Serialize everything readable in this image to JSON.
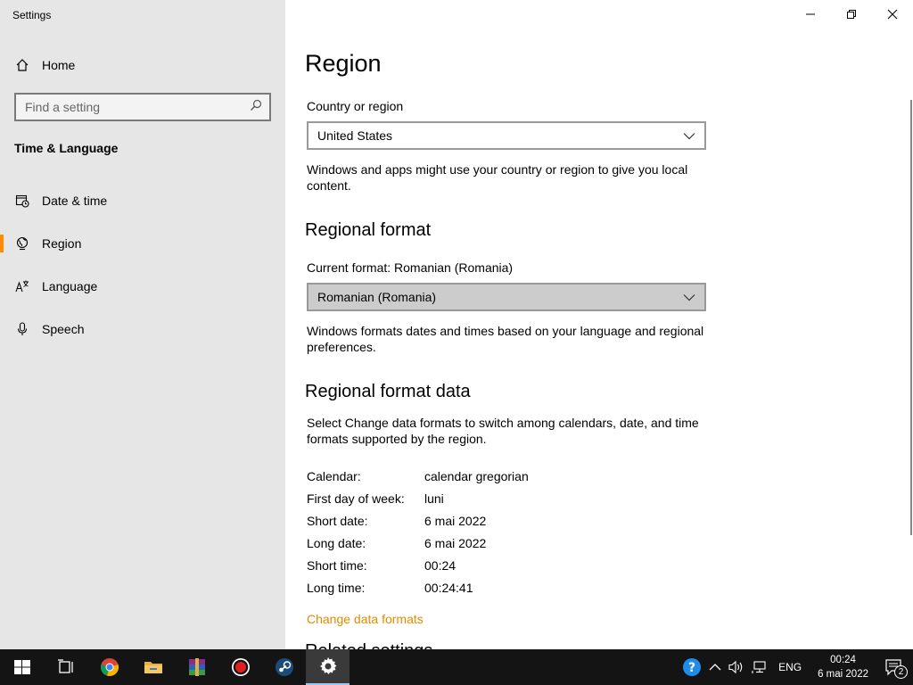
{
  "window": {
    "title": "Settings"
  },
  "sidebar": {
    "home_label": "Home",
    "search_placeholder": "Find a setting",
    "section_title": "Time & Language",
    "items": [
      {
        "label": "Date & time",
        "icon": "calendar-clock-icon"
      },
      {
        "label": "Region",
        "icon": "globe-icon",
        "active": true
      },
      {
        "label": "Language",
        "icon": "language-icon"
      },
      {
        "label": "Speech",
        "icon": "microphone-icon"
      }
    ],
    "accent": "#ff8c00"
  },
  "main": {
    "title": "Region",
    "country": {
      "label": "Country or region",
      "value": "United States",
      "desc": "Windows and apps might use your country or region to give you local content."
    },
    "regional_format": {
      "title": "Regional format",
      "current_label": "Current format: Romanian (Romania)",
      "value": "Romanian (Romania)",
      "desc": "Windows formats dates and times based on your language and regional preferences."
    },
    "format_data": {
      "title": "Regional format data",
      "desc": "Select Change data formats to switch among calendars, date, and time formats supported by the region.",
      "rows": [
        {
          "k": "Calendar:",
          "v": "calendar gregorian"
        },
        {
          "k": "First day of week:",
          "v": "luni"
        },
        {
          "k": "Short date:",
          "v": "6 mai 2022"
        },
        {
          "k": "Long date:",
          "v": "6 mai 2022"
        },
        {
          "k": "Short time:",
          "v": "00:24"
        },
        {
          "k": "Long time:",
          "v": "00:24:41"
        }
      ],
      "change_link": "Change data formats",
      "link_color": "#e38b00"
    },
    "related_partial": "Related settings"
  },
  "taskbar": {
    "language": "ENG",
    "time": "00:24",
    "date": "6 mai 2022",
    "notification_count": "2"
  }
}
